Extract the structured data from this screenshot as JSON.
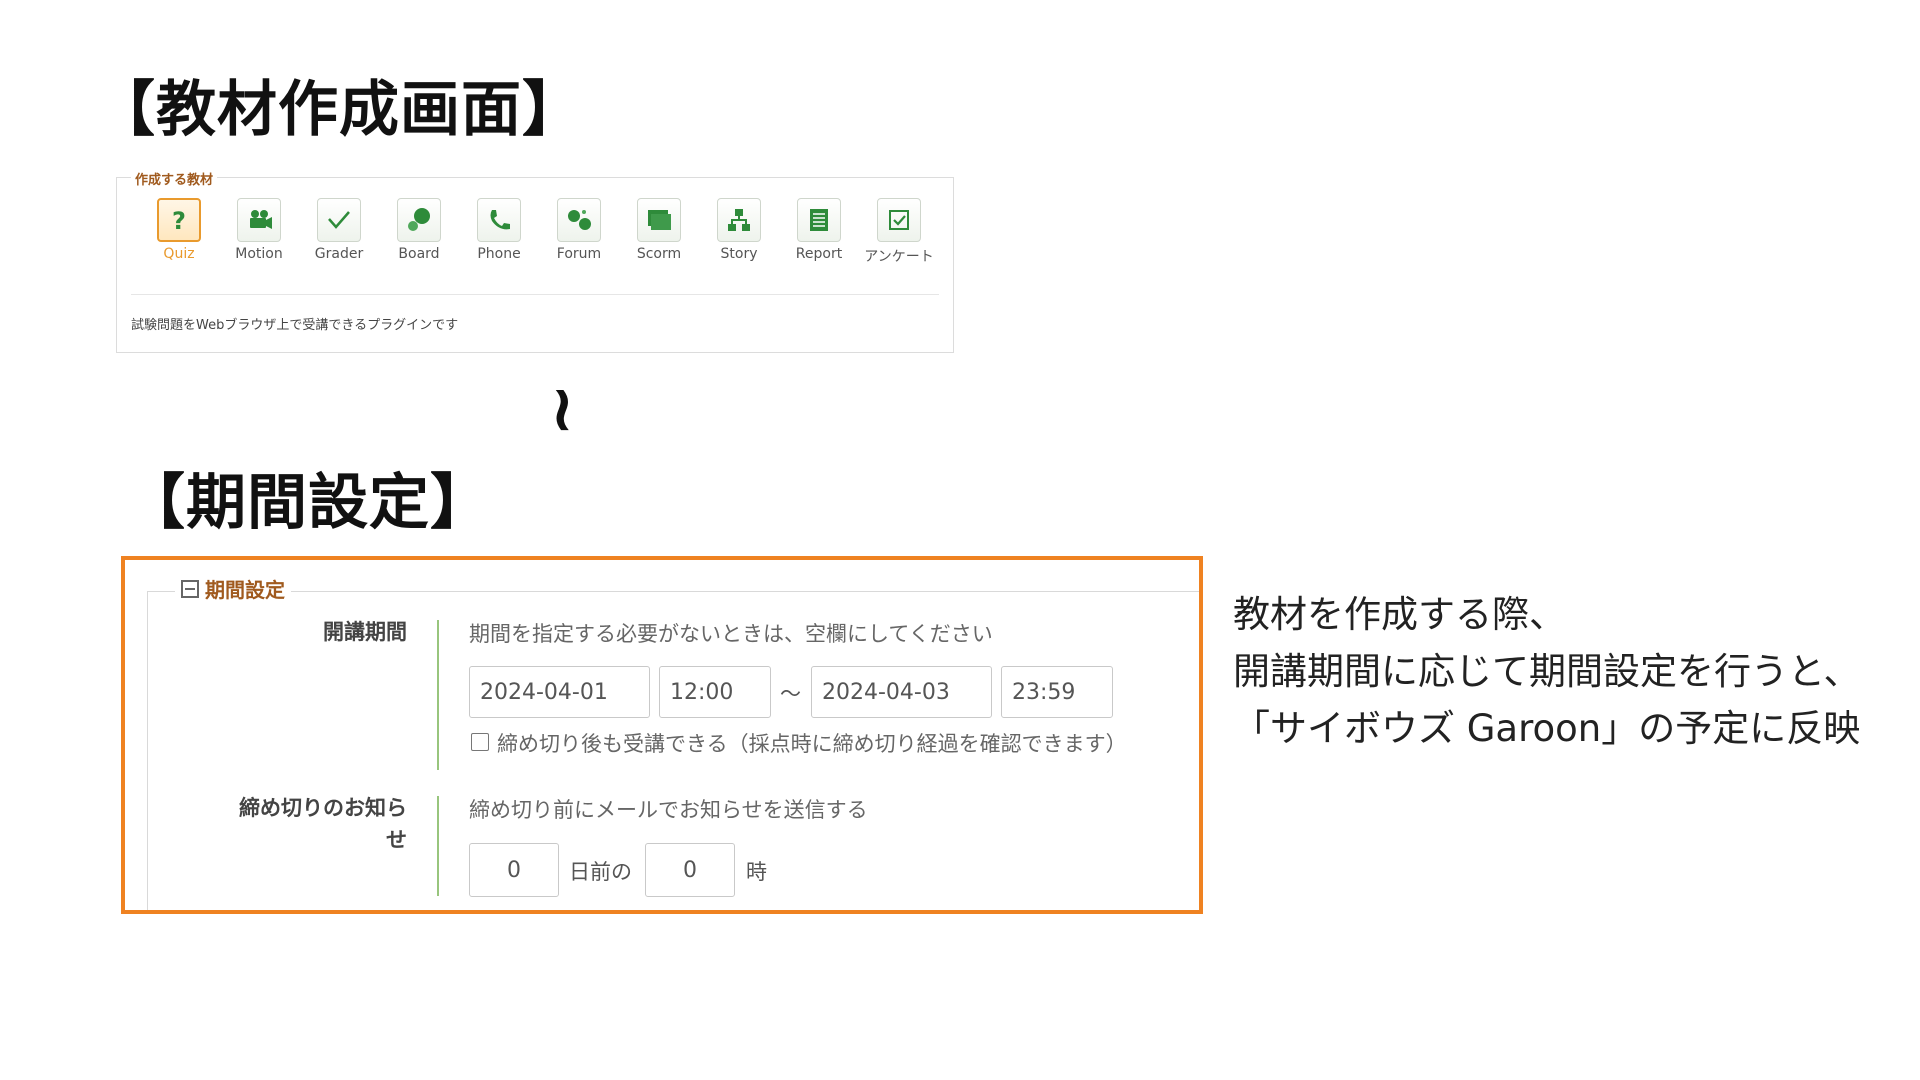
{
  "headings": {
    "create": "【教材作成画面】",
    "period": "【期間設定】"
  },
  "plugin_panel": {
    "legend": "作成する教材",
    "selected": "Quiz",
    "plugins": [
      {
        "label": "Quiz",
        "icon": "question-icon"
      },
      {
        "label": "Motion",
        "icon": "video-camera-icon"
      },
      {
        "label": "Grader",
        "icon": "checkmark-icon"
      },
      {
        "label": "Board",
        "icon": "speech-bubbles-icon"
      },
      {
        "label": "Phone",
        "icon": "phone-icon"
      },
      {
        "label": "Forum",
        "icon": "forum-icon"
      },
      {
        "label": "Scorm",
        "icon": "package-icon"
      },
      {
        "label": "Story",
        "icon": "tree-diagram-icon"
      },
      {
        "label": "Report",
        "icon": "document-icon"
      },
      {
        "label": "アンケート",
        "icon": "checkbox-icon"
      }
    ],
    "description": "試験問題をWebブラウザ上で受講できるプラグインです"
  },
  "arrow_glyph": "~",
  "period_panel": {
    "legend": "期間設定",
    "course_period": {
      "label": "開講期間",
      "hint": "期間を指定する必要がないときは、空欄にしてください",
      "start_date": "2024-04-01",
      "start_time": "12:00",
      "separator": "～",
      "end_date": "2024-04-03",
      "end_time": "23:59",
      "allow_after_deadline": {
        "checked": false,
        "label": "締め切り後も受講できる（採点時に締め切り経過を確認できます）"
      }
    },
    "deadline_notice": {
      "label_line1": "締め切りのお知ら",
      "label_line2": "せ",
      "hint": "締め切り前にメールでお知らせを送信する",
      "days": "0",
      "days_suffix": "日前の",
      "hours": "0",
      "hours_suffix": "時"
    }
  },
  "side_note": {
    "line1": "教材を作成する際、",
    "line2": "開講期間に応じて期間設定を行うと、",
    "line3": "「サイボウズ Garoon」の予定に反映"
  },
  "colors": {
    "accent_orange": "#ef8221",
    "legend_brown": "#a05a1e",
    "icon_green": "#2e8b3a",
    "bar_green": "#98c57d"
  }
}
